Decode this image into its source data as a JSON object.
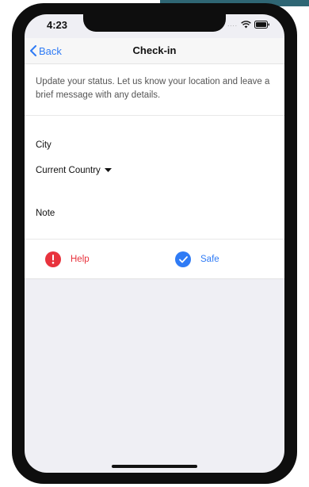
{
  "status_bar": {
    "time": "4:23",
    "signal": "...."
  },
  "nav": {
    "back_label": "Back",
    "title": "Check-in"
  },
  "intro_text": "Update your status. Let us know your location and leave a brief message with any details.",
  "form": {
    "city_label": "City",
    "country_label": "Current Country",
    "note_label": "Note"
  },
  "actions": {
    "help_label": "Help",
    "help_color": "#e8333d",
    "safe_label": "Safe",
    "safe_color": "#2f7bf5"
  }
}
